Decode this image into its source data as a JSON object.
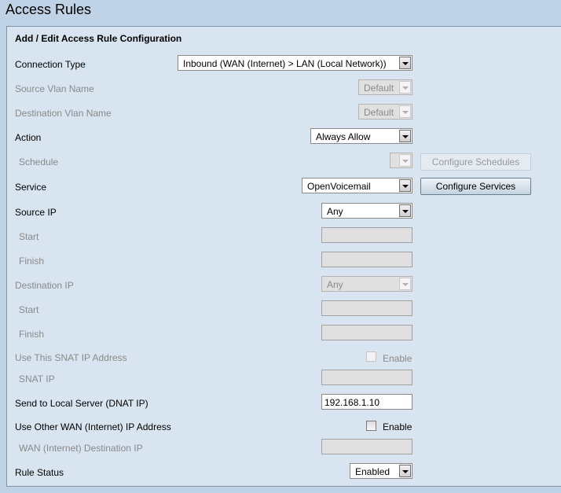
{
  "page": {
    "title": "Access Rules"
  },
  "panel": {
    "title": "Add / Edit Access Rule Configuration"
  },
  "fields": {
    "connection_type": {
      "label": "Connection Type",
      "value": "Inbound (WAN (Internet) > LAN (Local Network))",
      "disabled": false
    },
    "source_vlan": {
      "label": "Source Vlan Name",
      "value": "Default",
      "disabled": true
    },
    "destination_vlan": {
      "label": "Destination Vlan Name",
      "value": "Default",
      "disabled": true
    },
    "action": {
      "label": "Action",
      "value": "Always Allow",
      "disabled": false
    },
    "schedule": {
      "label": "Schedule",
      "value": "",
      "disabled": true,
      "button_label": "Configure Schedules"
    },
    "service": {
      "label": "Service",
      "value": "OpenVoicemail",
      "disabled": false,
      "button_label": "Configure Services"
    },
    "source_ip": {
      "label": "Source IP",
      "value": "Any",
      "disabled": false
    },
    "source_start": {
      "label": "Start",
      "value": "",
      "disabled": true
    },
    "source_finish": {
      "label": "Finish",
      "value": "",
      "disabled": true
    },
    "destination_ip": {
      "label": "Destination IP",
      "value": "Any",
      "disabled": true
    },
    "destination_start": {
      "label": "Start",
      "value": "",
      "disabled": true
    },
    "destination_finish": {
      "label": "Finish",
      "value": "",
      "disabled": true
    },
    "use_snat": {
      "label": "Use This SNAT IP Address",
      "checkbox_label": "Enable",
      "checked": false,
      "disabled": true
    },
    "snat_ip": {
      "label": "SNAT IP",
      "value": "",
      "disabled": true
    },
    "dnat_ip": {
      "label": "Send to Local Server (DNAT IP)",
      "value": "192.168.1.10",
      "disabled": false
    },
    "use_other_wan": {
      "label": "Use Other WAN (Internet) IP Address",
      "checkbox_label": "Enable",
      "checked": false,
      "disabled": false
    },
    "wan_dest_ip": {
      "label": "WAN (Internet) Destination IP",
      "value": "",
      "disabled": true
    },
    "rule_status": {
      "label": "Rule Status",
      "value": "Enabled",
      "disabled": false
    }
  }
}
